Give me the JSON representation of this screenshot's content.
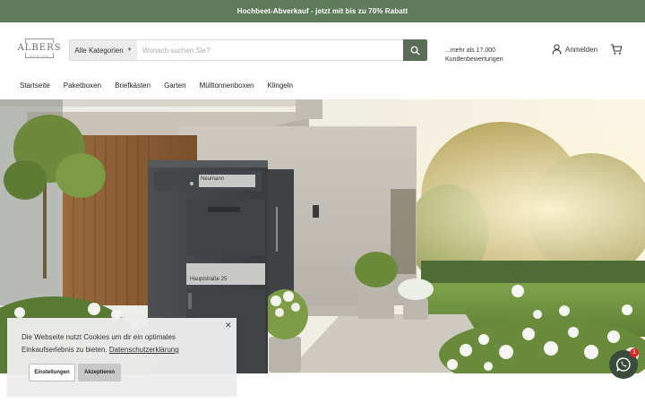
{
  "promo": {
    "text": "Hochbeet-Abverkauf - jetzt mit bis zu 70% Rabatt"
  },
  "header": {
    "logo": {
      "text": "ALBERS",
      "subtext": "DESIGN"
    },
    "search": {
      "category_label": "Alle Kategorien",
      "placeholder": "Wonach suchen Sie?",
      "button_icon": "search-icon"
    },
    "reviews": {
      "line1": "...mehr als 17.000",
      "line2": "Kundenbewertungen"
    },
    "login_label": "Anmelden",
    "cart_icon": "cart-icon"
  },
  "nav": {
    "items": [
      {
        "label": "Startseite"
      },
      {
        "label": "Paketboxen"
      },
      {
        "label": "Briefkästen"
      },
      {
        "label": "Garten"
      },
      {
        "label": "Mülltonnenboxen"
      },
      {
        "label": "Klingeln"
      }
    ]
  },
  "hero": {
    "mailbox_top_label": "Neumann",
    "mailbox_bottom_label": "Hauptstraße 25"
  },
  "cookie": {
    "text": "Die Webseite nutzt Cookies um dir ein optimales Einkaufserlebnis zu bieten.",
    "link": "Datenschutzerklärung",
    "settings_label": "Einstellungen",
    "accept_label": "Akzeptieren",
    "close_icon": "close-icon"
  },
  "chat": {
    "badge": "1",
    "icon": "whatsapp-icon"
  },
  "colors": {
    "promo_bg": "#5f7b5a",
    "search_button": "#5a6e57",
    "chat_bg": "#3a4a3c",
    "badge": "#e32424"
  }
}
